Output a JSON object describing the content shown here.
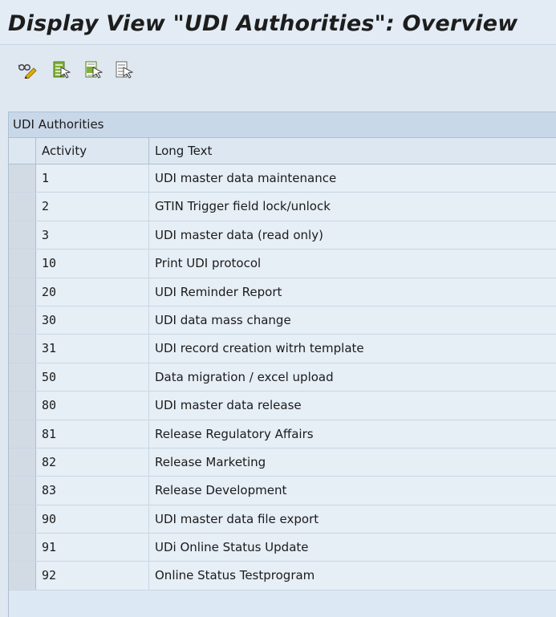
{
  "window": {
    "title": "Display View \"UDI Authorities\": Overview"
  },
  "toolbar": {
    "buttons": [
      {
        "icon": "display-change-icon"
      },
      {
        "icon": "select-all-icon"
      },
      {
        "icon": "select-block-icon"
      },
      {
        "icon": "deselect-all-icon"
      }
    ]
  },
  "table": {
    "caption": "UDI Authorities",
    "columns": [
      "Activity",
      "Long Text"
    ],
    "rows": [
      {
        "activity": "1",
        "text": "UDI master data maintenance"
      },
      {
        "activity": "2",
        "text": "GTIN Trigger field lock/unlock"
      },
      {
        "activity": "3",
        "text": "UDI master data (read only)"
      },
      {
        "activity": "10",
        "text": "Print UDI protocol"
      },
      {
        "activity": "20",
        "text": "UDI Reminder Report"
      },
      {
        "activity": "30",
        "text": "UDI data mass change"
      },
      {
        "activity": "31",
        "text": "UDI record creation witrh template"
      },
      {
        "activity": "50",
        "text": "Data migration / excel upload"
      },
      {
        "activity": "80",
        "text": "UDI master data release"
      },
      {
        "activity": "81",
        "text": "Release Regulatory Affairs"
      },
      {
        "activity": "82",
        "text": "Release Marketing"
      },
      {
        "activity": "83",
        "text": "Release Development"
      },
      {
        "activity": "90",
        "text": "UDI master data file export"
      },
      {
        "activity": "91",
        "text": "UDi Online Status Update"
      },
      {
        "activity": "92",
        "text": "Online Status Testprogram"
      }
    ]
  }
}
